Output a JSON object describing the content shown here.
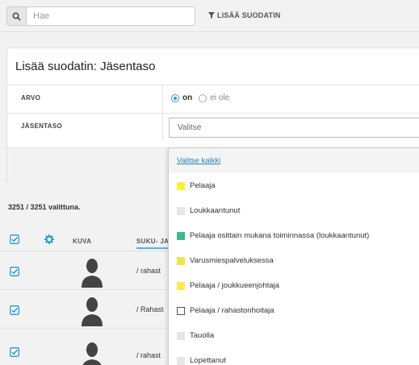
{
  "search": {
    "placeholder": "Hae"
  },
  "toolbar": {
    "add_filter_label": "LISÄÄ SUODATIN"
  },
  "filter_panel": {
    "title": "Lisää suodatin: Jäsentaso",
    "arvo_label": "ARVO",
    "option_on": "on",
    "option_off": "ei ole",
    "selected_option": "on",
    "jasentaso_label": "JÄSENTASO",
    "select_placeholder": "Valitse"
  },
  "dropdown": {
    "select_all": "Valitse kaikki",
    "options": [
      {
        "label": "Pelaaja",
        "color": "#ffef3a"
      },
      {
        "label": "Loukkaantunut",
        "color": "#e6e6e6"
      },
      {
        "label": "Pelaaja osittain mukana toiminnassa (loukkaantunut)",
        "color": "#3fb88f"
      },
      {
        "label": "Varusmiespalveluksessa",
        "color": "#f1e34f"
      },
      {
        "label": "Pelaaja / joukkueenjohtaja",
        "color": "#ffe852"
      },
      {
        "label": "Pelaaja / rahastonhoitaja",
        "color": "#ffffff"
      },
      {
        "label": "Tauolla",
        "color": "#e6e6e6"
      },
      {
        "label": "Lopettanut",
        "color": "#e6e6e6"
      }
    ]
  },
  "results": {
    "count_text": "3251 / 3251 valittuna.",
    "columns": {
      "photo": "KUVA",
      "surname": "SUKU- JA"
    },
    "rows": [
      {
        "name": "/ rahast"
      },
      {
        "name": "/ Rahast"
      },
      {
        "name": "/ rahast"
      }
    ]
  },
  "colors": {
    "accent": "#2d9bc9",
    "link": "#2d7fb8"
  }
}
